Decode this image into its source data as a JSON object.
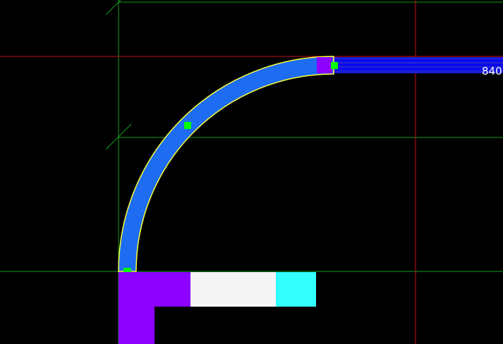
{
  "viewport": {
    "background": "#000000"
  },
  "colors": {
    "grid_green": "#0fa01a",
    "grid_red": "#c80f0f",
    "duct_fill": "#1d6cf2",
    "selection_outline": "#ffff3c",
    "grip": "#00ff00",
    "magenta_block": "#8c00ff",
    "white_block": "#f5f5f5",
    "cyan_block": "#33ffff",
    "conduit_blue": "#1c1cd8",
    "conduit_line": "#0000ff",
    "dimension_text": "#ffffff"
  },
  "duct_fitting": {
    "kind": "elbow",
    "selected": true,
    "grip_count": 3
  },
  "dimension": {
    "text": "840"
  }
}
